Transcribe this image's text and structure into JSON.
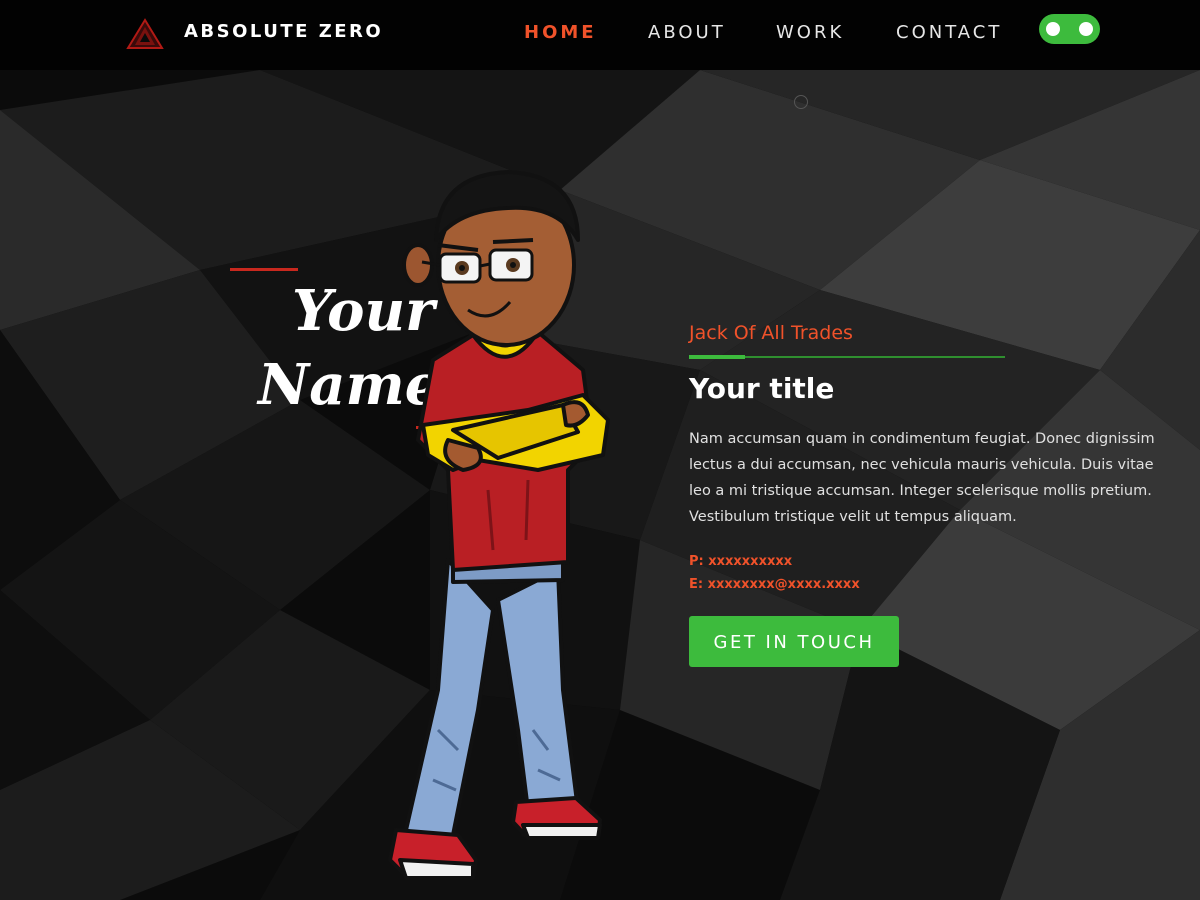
{
  "nav": {
    "brand": "ABSOLUTE ZERO",
    "links": [
      "HOME",
      "ABOUT",
      "WORK",
      "CONTACT"
    ],
    "active": "HOME",
    "theme_toggle": {
      "on": true
    }
  },
  "hero": {
    "name_line1": "Your",
    "name_line2": "Name",
    "tagline": "Jack Of All Trades",
    "title": "Your title",
    "description": "Nam accumsan quam in condimentum feugiat. Donec dignissim lectus a dui accumsan, nec vehicula mauris vehicula. Duis vitae leo a mi tristique accumsan. Integer scelerisque mollis pretium. Vestibulum tristique velit ut tempus aliquam.",
    "phone": "P: xxxxxxxxxx",
    "email": "E: xxxxxxxx@xxxx.xxxx",
    "cta": "GET IN TOUCH"
  },
  "colors": {
    "accent": "#f0522a",
    "toggle": "#3dbb3d",
    "cta": "#3dbb3d",
    "name_bar": "#c8281e",
    "background": "#0a0a0a"
  },
  "icons": {
    "logo": "triangle-logo-icon",
    "toggle": "theme-toggle"
  }
}
